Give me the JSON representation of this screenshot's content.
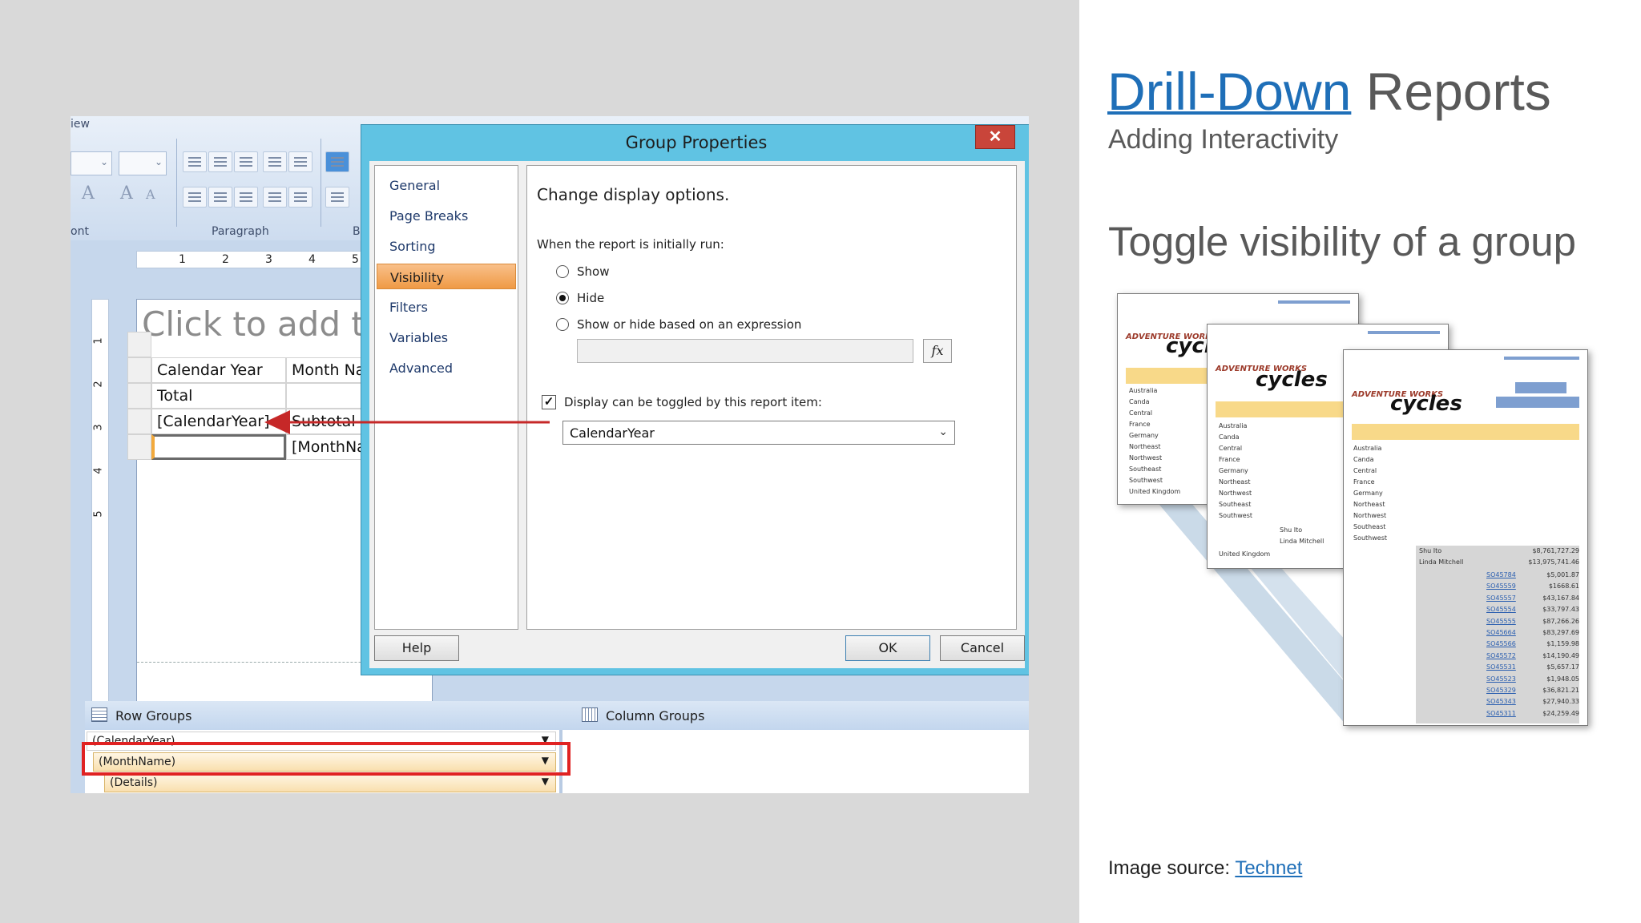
{
  "slide": {
    "title_link": "Drill-Down",
    "title_rest": " Reports",
    "subtitle": "Adding Interactivity",
    "heading": "Toggle visibility of a group",
    "image_source_label": "Image source: ",
    "image_source_link": "Technet"
  },
  "ribbon": {
    "view_tab": "iew",
    "font_group_label": "ont",
    "paragraph_group_label": "Paragraph",
    "b_group_label": "B"
  },
  "ruler": {
    "h_marks": [
      "1",
      "2",
      "3",
      "4",
      "5"
    ],
    "v_marks": [
      "1",
      "2",
      "3",
      "4",
      "5"
    ]
  },
  "design": {
    "title_placeholder": "Click to add tit",
    "header_col1": "Calendar Year",
    "header_col2": "Month Nam",
    "total": "Total",
    "calendar_year_field": "[CalendarYear]",
    "subtotal": "Subtotal",
    "month_name_field": "[MonthNam"
  },
  "dialog": {
    "title": "Group Properties",
    "close_symbol": "✕",
    "nav": [
      "General",
      "Page Breaks",
      "Sorting",
      "Visibility",
      "Filters",
      "Variables",
      "Advanced"
    ],
    "selected_nav": "Visibility",
    "heading": "Change display options.",
    "when_label": "When the report is initially run:",
    "radio_show": "Show",
    "radio_hide": "Hide",
    "radio_expr": "Show or hide based on an expression",
    "fx_label": "fx",
    "toggle_label": "Display can be toggled by this report item:",
    "toggle_value": "CalendarYear",
    "help": "Help",
    "ok": "OK",
    "cancel": "Cancel"
  },
  "groups": {
    "row_groups_label": "Row Groups",
    "column_groups_label": "Column Groups",
    "rows": [
      "(CalendarYear)",
      "(MonthName)",
      "(Details)"
    ]
  },
  "report_thumbs": {
    "brand": "ADVENTURE WORKS",
    "cycles": "cycles",
    "regions": [
      "Australia",
      "Canda",
      "Central",
      "France",
      "Germany",
      "Northeast",
      "Northwest",
      "Southeast",
      "Southwest",
      "United Kingdom"
    ],
    "people": [
      "Shu Ito",
      "Linda Mitchell"
    ],
    "totals": [
      "$8,761,727.29",
      "$13,975,741.46"
    ],
    "orders": [
      "SO45784",
      "SO45559",
      "SO45557",
      "SO45554",
      "SO45555",
      "SO45664",
      "SO45566",
      "SO45572",
      "SO45531",
      "SO45523",
      "SO45329",
      "SO45343",
      "SO45311"
    ],
    "amounts": [
      "$5,001.87",
      "$1668.61",
      "$43,167.84",
      "$33,797.43",
      "$87,266.26",
      "$83,297.69",
      "$1,159.98",
      "$14,190.49",
      "$5,657.17",
      "$1,948.05",
      "$36,821.21",
      "$27,940.33",
      "$24,259.49"
    ]
  },
  "colors": {
    "accent_link": "#1f6fb8",
    "dialog_titlebar": "#60c3e3",
    "selected_nav": "#ef9a45",
    "highlight_box": "#e02222",
    "arrow": "#c62828"
  }
}
